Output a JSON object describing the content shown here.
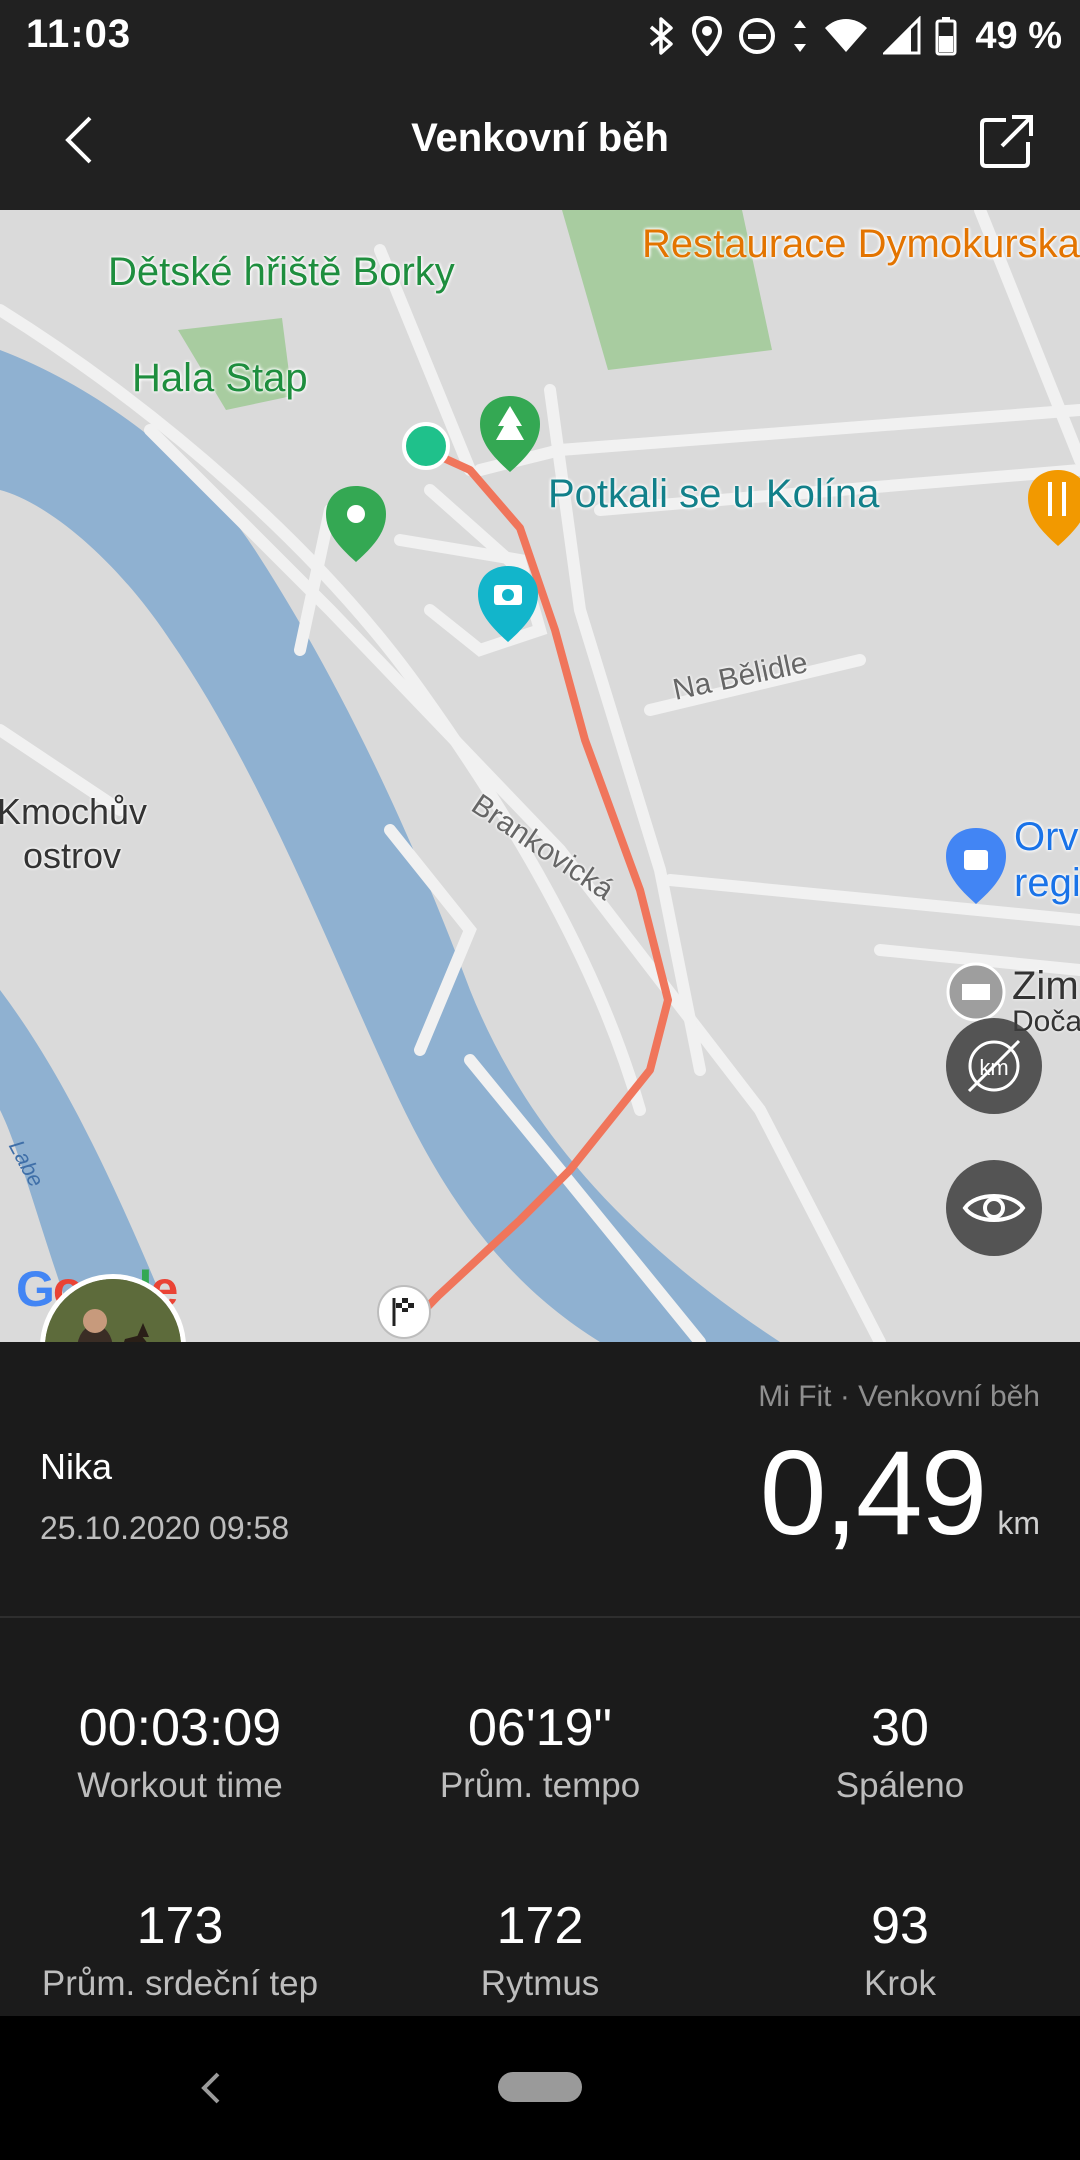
{
  "status_bar": {
    "time": "11:03",
    "battery_percent": "49 %"
  },
  "header": {
    "title": "Venkovní běh"
  },
  "map": {
    "poi": {
      "playground": "Dětské hřiště Borky",
      "restaurant": "Restaurace Dymokurska",
      "hall": "Hala Stap",
      "photo_spot": "Potkali se u Kolína",
      "shop_line1": "Orv",
      "shop_line2": "regi",
      "other_line1": "Zim",
      "other_line2": "Doča"
    },
    "streets": {
      "na_belidle": "Na Bělidle",
      "brankovicka": "Brankovická"
    },
    "island_line1": "Kmochův",
    "island_line2": "ostrov",
    "river": "Labe",
    "attribution": "Google",
    "colors": {
      "route": "#f0755b",
      "water": "#8fb1d1",
      "land": "#dadada",
      "park": "#a8cca0",
      "start_marker": "#1fc18b"
    }
  },
  "workout": {
    "user_name": "Nika",
    "datetime": "25.10.2020 09:58",
    "source": "Mi Fit · Venkovní běh",
    "distance": "0,49",
    "distance_unit": "km"
  },
  "stats": [
    {
      "value": "00:03:09",
      "label": "Workout time"
    },
    {
      "value": "06'19\"",
      "label": "Prům. tempo"
    },
    {
      "value": "30",
      "label": "Spáleno"
    },
    {
      "value": "173",
      "label": "Prům. srdeční tep"
    },
    {
      "value": "172",
      "label": "Rytmus"
    },
    {
      "value": "93",
      "label": "Krok"
    }
  ]
}
